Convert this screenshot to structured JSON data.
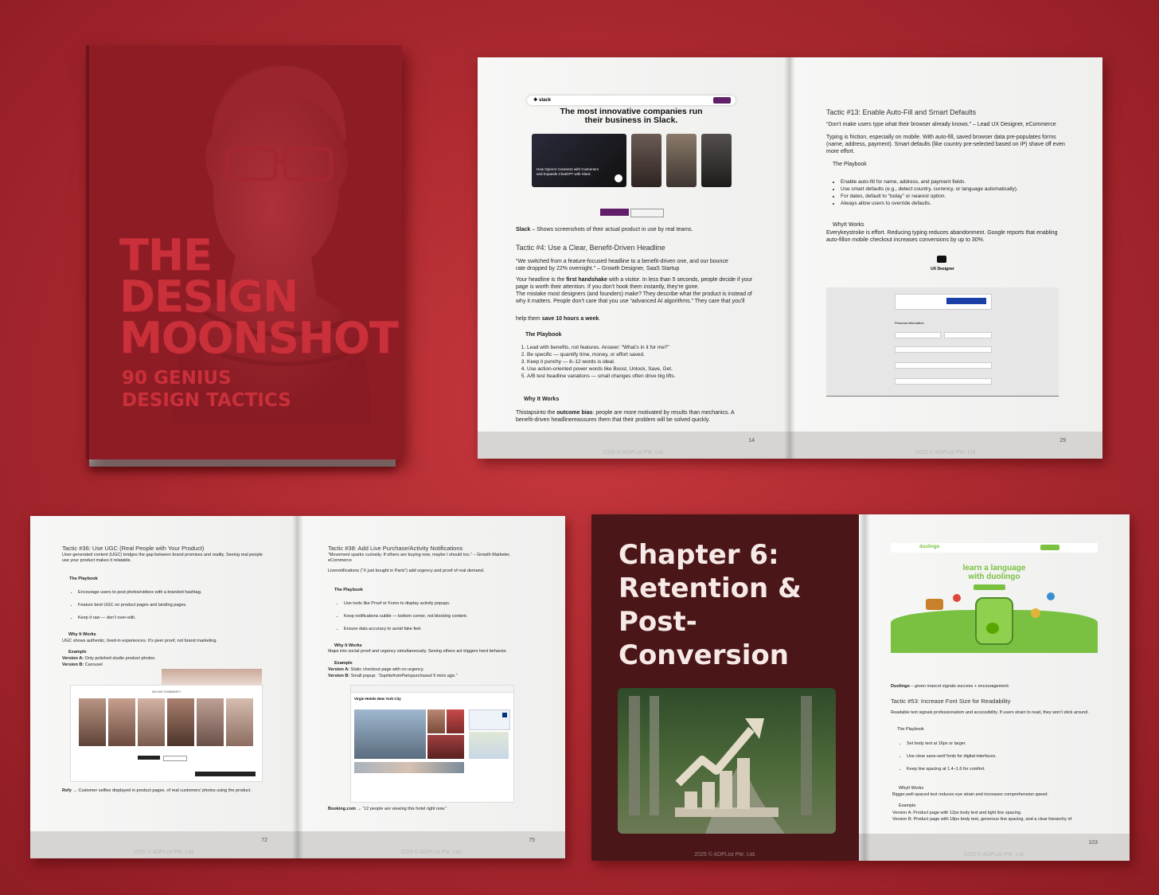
{
  "cover": {
    "title_lines": [
      "THE",
      "DESIGN",
      "MOONSHOT"
    ],
    "subtitle_lines": [
      "90 GENIUS",
      "DESIGN TACTICS"
    ]
  },
  "spread1": {
    "left": {
      "slack_heading_1": "The most innovative companies run",
      "slack_heading_2": "their business in Slack.",
      "slack_card_text": "How OpenAI Connects with Customers and Expands ChatGPT with Slack",
      "slack_caption_bold": "Slack",
      "slack_caption": " – Shows screenshots of their actual product in use by real teams.",
      "tactic_title": "Tactic #4: Use a Clear, Benefit-Driven Headline",
      "quote": "“We switched from a feature-focused headline to a benefit-driven one, and our bounce rate dropped by 22% overnight.” – Growth Designer, SaaS Startup",
      "para1_a": "Your headline is the ",
      "para1_bold": "first handshake",
      "para1_b": " with a visitor. In less than 5 seconds, people decide if your page is worth their attention. If you don’t hook them instantly, they’re gone.",
      "para2": "The mistake most designers (and founders) make? They describe what the product is instead of why it matters. People don’t care that you use “advanced AI algorithms.” They care that you’ll",
      "para3_a": "help them ",
      "para3_bold": "save 10 hours a week",
      "para3_b": ".",
      "playbook_title": "The Playbook",
      "playbook": [
        "Lead with benefits, not features. Answer: “What’s in it for me?”",
        "Be specific — quantify time, money, or effort saved.",
        "Keep it punchy — 8–12 words is ideal.",
        "Use action-oriented power words like Boost, Unlock, Save, Get.",
        "A/B test headline variations — small changes often drive big lifts."
      ],
      "why_title": "Why It Works",
      "why_a": "Thistapsinto the ",
      "why_bold": "outcome bias",
      "why_b": ": people are more motivated by results than mechanics. A benefit-driven headlinereassures them that their problem will be solved quickly.",
      "page_number": "14",
      "copyright": "2025 © ADPList Pte. Ltd."
    },
    "right": {
      "tactic_title": "Tactic #13: Enable Auto-Fill and Smart Defaults",
      "quote": "“Don’t make users type what their browser already knows.” – Lead UX Designer, eCommerce",
      "para": "Typing is friction, especially on mobile. With auto-fill, saved browser data pre-populates forms (name, address, payment). Smart defaults (like country pre-selected based on IP) shave off even more effort.",
      "playbook_title": "The Playbook",
      "playbook": [
        "Enable auto-fill for name, address, and payment fields.",
        "Use smart defaults (e.g., detect country, currency, or language automatically).",
        "For dates, default to “today” or nearest option.",
        "Always allow users to override defaults."
      ],
      "why_title": "WhyIt Works",
      "why": "Everykeystroke is effort. Reducing typing reduces abandonment. Google reports that enabling auto-fillon mobile checkout increases conversions by up to 30%.",
      "form_title": "UX Designer",
      "form_section": "Personal information",
      "page_number": "29",
      "copyright": "2025 © ADPList Pte. Ltd."
    }
  },
  "spread2": {
    "left": {
      "tactic_title": "Tactic #36: Use UGC (Real People with Your Product)",
      "intro": "User-generated content (UGC) bridges the gap between brand promises and reality. Seeing real people use your product makes it relatable.",
      "playbook_title": "The Playbook",
      "playbook": [
        "Encourage users to post photos/videos with a branded hashtag.",
        "Feature best UGC on product pages and landing pages.",
        "Keep it raw — don’t over-edit."
      ],
      "why_title": "Why It Works",
      "why": "UGC shows authentic, lived-in experiences. It’s peer proof, not brand marketing.",
      "example_title": "Example",
      "version_a_label": "Version A:",
      "version_a": " Only polished studio product photos.",
      "version_b_label": "Version B:",
      "version_b": " Carousel",
      "community_label": "ON OUR COMMUNITY",
      "caption_bold": "Refy",
      "caption": " → Customer selfies displayed in product pages. of real customers’ photos using the product.",
      "page_number": "72",
      "copyright": "2025 © ADPList Pte. Ltd."
    },
    "right": {
      "tactic_title": "Tactic #38: Add Live Purchase/Activity Notifications",
      "quote": "“Movement sparks curiosity. If others are buying now, maybe I should too.” – Growth Marketer, eCommerce",
      "intro": "Livenotifications (“X just bought in Paris”) add urgency and proof of real demand.",
      "playbook_title": "The Playbook",
      "playbook": [
        "Use tools like Proof or Fomo to display activity popups.",
        "Keep notifications subtle — bottom corner, not blocking content.",
        "Ensure data accuracy to avoid fake feel."
      ],
      "why_title": "Why It Works",
      "why_a": "Ittaps into social proof ",
      "why_italic": "and",
      "why_b": " urgency simultaneously. Seeing others act triggers herd behavior.",
      "example_title": "Example",
      "version_a_label": "Version A:",
      "version_a": " Static checkout page with no urgency.",
      "version_b_label": "Version B:",
      "version_b_a": " Small popup: ",
      "version_b_italic": "“SophiefromParispurchased 5 mins ago.”",
      "hotel_name": "Virgin Hotels New York City",
      "caption_bold": "Booking.com",
      "caption": " → “12 people are viewing this hotel right now.”",
      "page_number": "75",
      "copyright": "2025 © ADPList Pte. Ltd."
    }
  },
  "spread3": {
    "left": {
      "chapter_title_lines": [
        "Chapter 6:",
        "Retention &",
        "Post-",
        "Conversion"
      ],
      "copyright": "2025 © ADPList Pte. Ltd."
    },
    "right": {
      "brand": "duolingo",
      "hero_line1": "learn a language",
      "hero_line2": "with duolingo",
      "caption_bold": "Duolingo",
      "caption": " – green mascot signals success + encouragement.",
      "tactic_title": "Tactic #53: Increase Font Size for Readability",
      "intro": "Readable text signals professionalism and accessibility. If users strain to read, they won’t stick around.",
      "playbook_title": "The Playbook",
      "playbook": [
        "Set body text at 16px or larger.",
        "Use clear sans-serif fonts for digital interfaces.",
        "Keep line spacing at 1.4–1.6 for comfort."
      ],
      "why_title": "WhyIt Works",
      "why": "Bigger,well-spaced text reduces eye strain and increases comprehension speed.",
      "example_title": "Example",
      "version_a": "Version A: Product page with 12px body text and tight line spacing.",
      "version_b": "Version B: Product page with 18px body text, generous line spacing, and a clear hierarchy of",
      "page_number": "103",
      "copyright": "2025 © ADPList Pte. Ltd."
    }
  },
  "colors": {
    "background": "#b22d33",
    "cover": "#8e1c25",
    "cover_text": "#c9303a",
    "chapter_bg": "#4a1618",
    "duolingo_green": "#7ac142"
  }
}
